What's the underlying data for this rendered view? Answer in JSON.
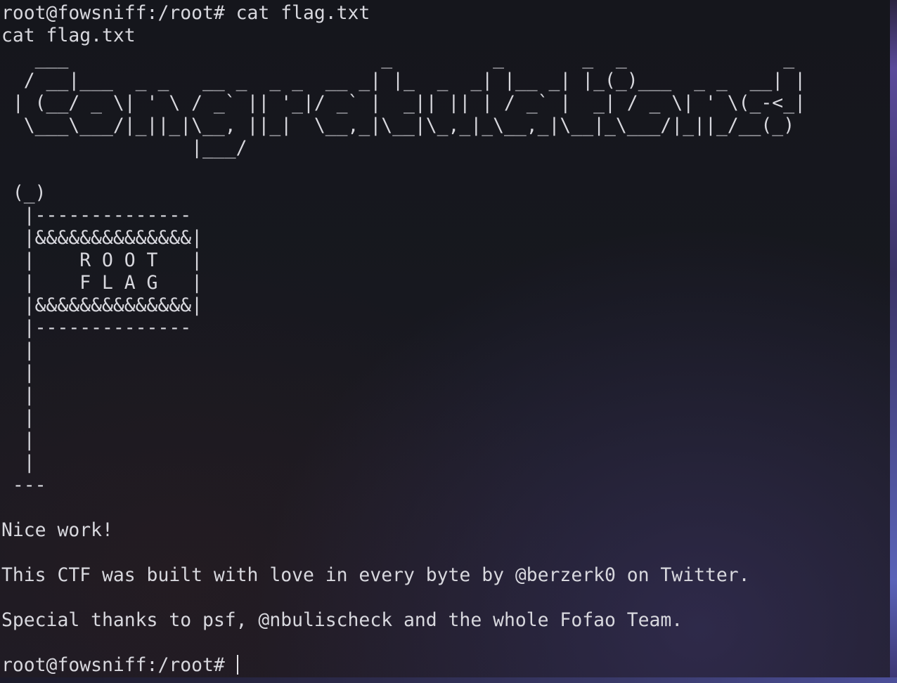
{
  "terminal": {
    "prompt_top": "root@fowsniff:/root# cat flag.txt",
    "echo": "cat flag.txt",
    "banner": [
      "   ___                            _         _       _  _              _ ",
      "  / __|___  _ _   __ _  _ _  __ _| |_  _  _| |__ _| |_(_)___  _ _  __| |",
      " | (__/ _ \\| ' \\ / _` || '_|/ _` |  _|| || | / _` |  _| / _ \\| ' \\(_-<_|",
      "  \\___\\___/|_||_|\\__, ||_|  \\__,_|\\__|\\_,_|_\\__,_|\\__|_\\___/|_||_/__(_)",
      "                 |___/                                                  "
    ],
    "flag_art": [
      " (_)",
      "  |--------------",
      "  |&&&&&&&&&&&&&&|",
      "  |    R O O T   |",
      "  |    F L A G   |",
      "  |&&&&&&&&&&&&&&|",
      "  |--------------",
      "  |",
      "  |",
      "  |",
      "  |",
      "  |",
      "  |",
      " ---"
    ],
    "message": "Nice work!",
    "credits": "This CTF was built with love in every byte by @berzerk0 on Twitter.",
    "thanks": "Special thanks to psf, @nbulischeck and the whole Fofao Team.",
    "prompt_bottom": "root@fowsniff:/root# "
  },
  "colors": {
    "foreground": "#d8d8de",
    "background": "#14151b"
  }
}
